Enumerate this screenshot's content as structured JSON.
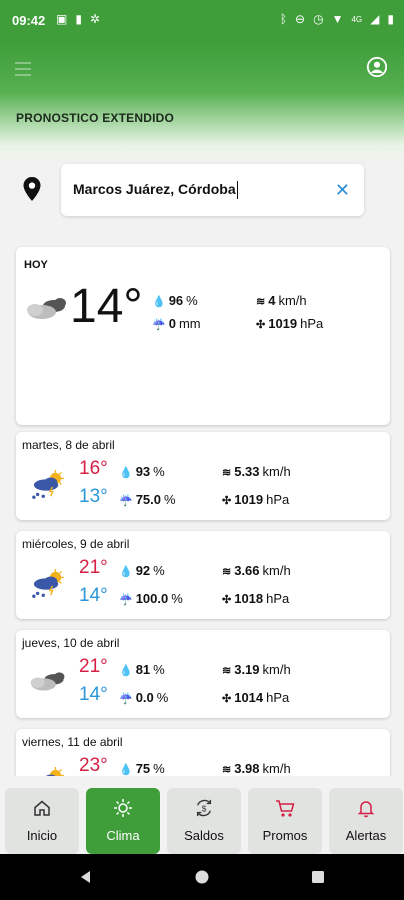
{
  "status_bar": {
    "time": "09:42",
    "network": "4G"
  },
  "header": {
    "title": "PRONOSTICO EXTENDIDO"
  },
  "search": {
    "value": "Marcos Juárez, Córdoba"
  },
  "today": {
    "label": "HOY",
    "temp": "14°",
    "humidity": "96",
    "humidity_unit": "%",
    "rain": "0",
    "rain_unit": "mm",
    "wind": "4",
    "wind_unit": "km/h",
    "pressure": "1019",
    "pressure_unit": "hPa",
    "icon": "cloudy-icon"
  },
  "days": [
    {
      "date": "martes, 8 de abril",
      "max": "16°",
      "min": "13°",
      "humidity": "93",
      "rain": "75.0",
      "wind": "5.33",
      "pressure": "1019",
      "icon": "storm-sun-icon"
    },
    {
      "date": "miércoles, 9 de abril",
      "max": "21°",
      "min": "14°",
      "humidity": "92",
      "rain": "100.0",
      "wind": "3.66",
      "pressure": "1018",
      "icon": "storm-sun-icon"
    },
    {
      "date": "jueves, 10 de abril",
      "max": "21°",
      "min": "14°",
      "humidity": "81",
      "rain": "0.0",
      "wind": "3.19",
      "pressure": "1014",
      "icon": "cloudy-icon"
    },
    {
      "date": "viernes, 11 de abril",
      "max": "23°",
      "min": "",
      "humidity": "75",
      "rain": "",
      "wind": "3.98",
      "pressure": "",
      "icon": "storm-sun-icon"
    }
  ],
  "units": {
    "percent": "%",
    "kmh": "km/h",
    "hpa": "hPa"
  },
  "nav": [
    {
      "label": "Inicio",
      "icon": "home-icon"
    },
    {
      "label": "Clima",
      "icon": "sun-icon",
      "active": true
    },
    {
      "label": "Saldos",
      "icon": "refresh-dollar-icon"
    },
    {
      "label": "Promos",
      "icon": "cart-icon"
    },
    {
      "label": "Alertas",
      "icon": "bell-icon"
    }
  ],
  "colors": {
    "brand_green": "#3f9e3a",
    "temp_max": "#d51f44",
    "temp_min": "#2b97d6",
    "nav_red": "#d51f44"
  }
}
